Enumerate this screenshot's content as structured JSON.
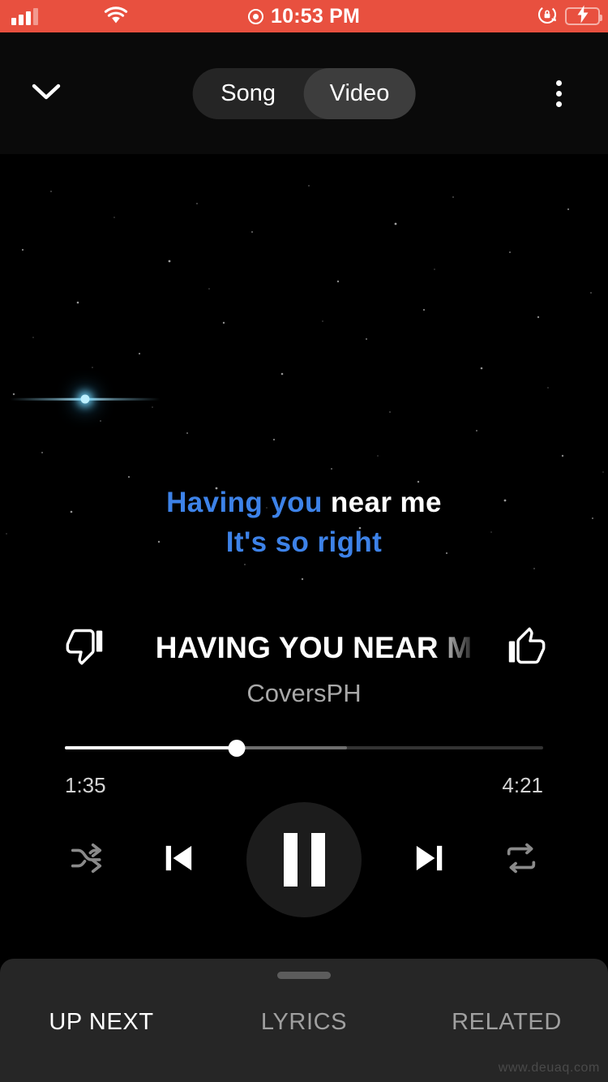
{
  "status_bar": {
    "background_color": "#e8503f",
    "signal_icon": "cellular-signal-icon",
    "signal_bars_active": 3,
    "signal_bars_total": 4,
    "wifi_icon": "wifi-icon",
    "record_icon": "record-indicator-icon",
    "time": "10:53 PM",
    "rotation_lock_icon": "rotation-lock-icon",
    "battery_icon": "battery-charging-icon",
    "battery_color": "#3ddc5b",
    "battery_charging": true
  },
  "header": {
    "collapse_icon": "chevron-down-icon",
    "overflow_icon": "more-vertical-icon",
    "segments": [
      {
        "label": "Song",
        "active": false
      },
      {
        "label": "Video",
        "active": true
      }
    ]
  },
  "video": {
    "lyrics": {
      "line1_sung": "Having you ",
      "line1_unsung": "near me",
      "line2": "It's so right",
      "sung_color": "#3d82e8",
      "unsung_color": "#ffffff"
    },
    "flare_icon": "lens-flare-star"
  },
  "player": {
    "dislike_icon": "thumbs-down-icon",
    "like_icon": "thumbs-up-icon",
    "title": "HAVING YOU NEAR M",
    "artist": "CoversPH",
    "elapsed": "1:35",
    "duration": "4:21",
    "progress_percent": 36,
    "buffered_percent": 59,
    "controls": {
      "shuffle_icon": "shuffle-icon",
      "previous_icon": "skip-previous-icon",
      "play_pause_icon": "pause-icon",
      "next_icon": "skip-next-icon",
      "repeat_icon": "repeat-icon"
    }
  },
  "bottom_sheet": {
    "handle_icon": "drag-handle",
    "tabs": [
      {
        "label": "UP NEXT",
        "active": true
      },
      {
        "label": "LYRICS",
        "active": false
      },
      {
        "label": "RELATED",
        "active": false
      }
    ]
  },
  "watermark": "www.deuaq.com"
}
